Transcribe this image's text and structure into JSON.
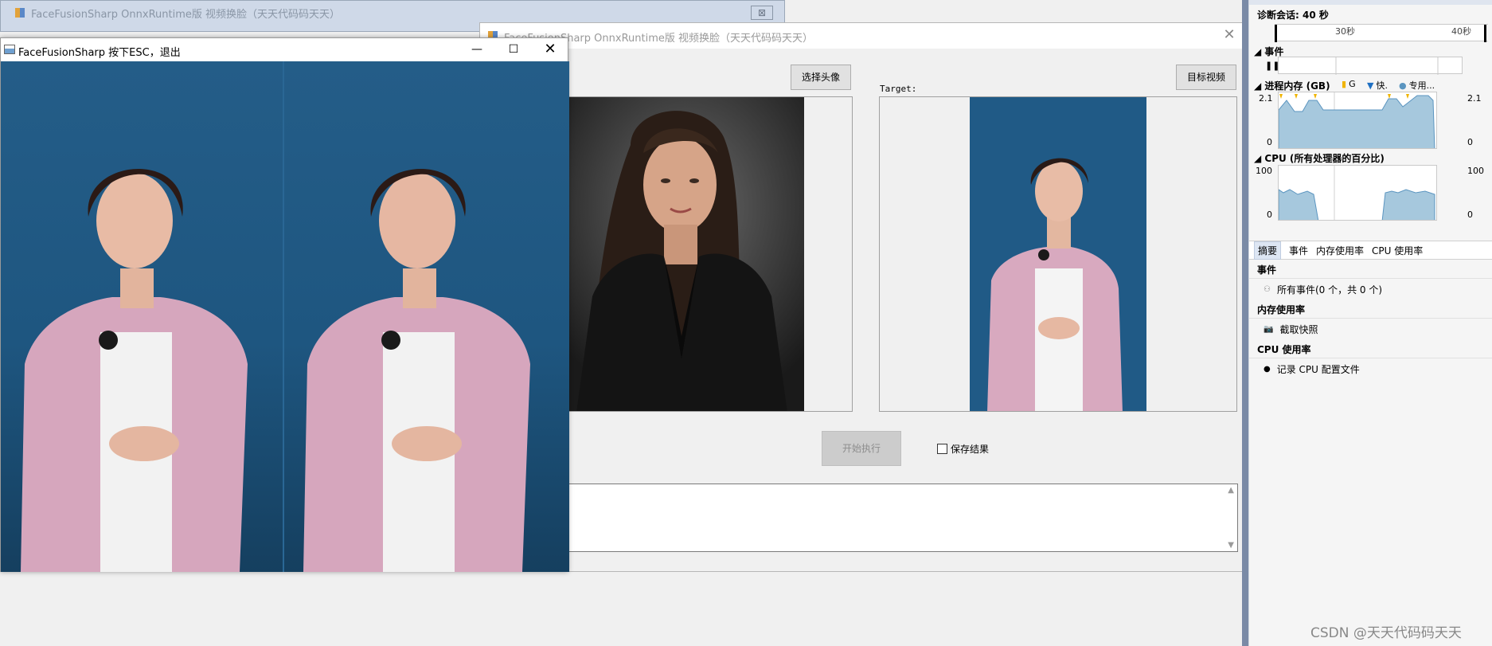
{
  "background_window": {
    "title": "FaceFusionSharp OnnxRuntime版 视频换脸（天天代码码天天）",
    "close": "⊠"
  },
  "main_window": {
    "title": "FaceFusionSharp OnnxRuntime版 视频换脸（天天代码码天天）",
    "close": "✕",
    "select_face_label": "选择头像",
    "target_video_label": "目标视频",
    "target_label": "Target:",
    "start_label": "开始执行",
    "save_result_label": "保存结果",
    "save_result_checked": false
  },
  "preview_window": {
    "title": "FaceFusionSharp 按下ESC，退出",
    "minimize": "—",
    "maximize": "☐",
    "close": "✕"
  },
  "diagnostics": {
    "session_label": "诊断会话: 40 秒",
    "timeline_ticks": [
      "30秒",
      "40秒"
    ],
    "events_section": "事件",
    "memory_section": "进程内存 (GB)",
    "legend": [
      "G",
      "快.",
      "专用..."
    ],
    "memory_axis": {
      "max": "2.1",
      "min": "0"
    },
    "cpu_section": "CPU (所有处理器的百分比)",
    "cpu_axis": {
      "max": "100",
      "min": "0"
    },
    "tabs": [
      "摘要",
      "事件",
      "内存使用率",
      "CPU 使用率"
    ],
    "summary": {
      "events_title": "事件",
      "events_item": "所有事件(0 个，共 0 个)",
      "memory_title": "内存使用率",
      "memory_item": "截取快照",
      "cpu_title": "CPU 使用率",
      "cpu_item": "记录 CPU 配置文件"
    },
    "colors": {
      "graph_fill": "#a6c8dd",
      "graph_line": "#5b95c0",
      "marker_yellow": "#f0b400",
      "marker_blue": "#1e6fc2"
    }
  },
  "watermark": "CSDN @天天代码码天天"
}
